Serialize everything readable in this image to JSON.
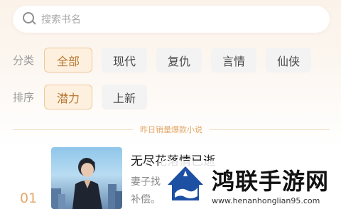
{
  "search": {
    "placeholder": "搜索书名"
  },
  "filters": {
    "category": {
      "label": "分类",
      "options": [
        "全部",
        "现代",
        "复仇",
        "言情",
        "仙侠"
      ],
      "selected": "全部"
    },
    "sort": {
      "label": "排序",
      "options": [
        "潜力",
        "上新"
      ],
      "selected": "潜力"
    }
  },
  "section": {
    "title": "昨日销量爆款小说"
  },
  "books": [
    {
      "rank": "01",
      "title": "无尽花落情已逝",
      "description_lines": [
        "妻子找",
        "补偿。"
      ]
    }
  ],
  "watermark": {
    "name": "鸿联手游网",
    "url": "www.henanhonglian95.com"
  },
  "colors": {
    "accent": "#b97a36",
    "accent_border": "#efc99c",
    "accent_bg": "#fdf0de",
    "rank": "#e4a86a",
    "watermark_blue": "#1d4fa3"
  },
  "icons": {
    "search": "search-icon"
  }
}
